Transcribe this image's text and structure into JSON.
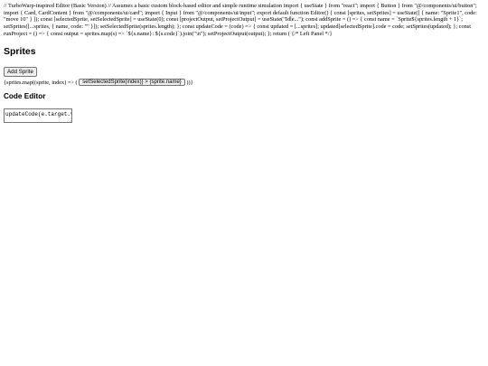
{
  "source_text": "// TurboWarp-inspired Editor (Basic Version) // Assumes a basic custom block-based editor and simple runtime simulation import { useState } from \"react\"; import { Button } from \"@/components/ui/button\"; import { Card, CardContent } from \"@/components/ui/card\"; import { Input } from \"@/components/ui/input\"; export default function Editor() { const [sprites, setSprites] = useState([ { name: \"Sprite1\", code: \"move 10\" } ]); const [selectedSprite, setSelectedSprite] = useState(0); const [projectOutput, setProjectOutput] = useState(\"Idle...\"); const addSprite = () => { const name = `Sprite${sprites.length + 1}`; setSprites([...sprites, { name, code: \"\" }]); setSelectedSprite(sprites.length); }; const updateCode = (code) => { const updated = [...sprites]; updated[selectedSprite].code = code; setSprites(updated); }; const runProject = () => { const output = sprites.map(s) => `${s.name}: ${s.code}`).join(\"\\n\"); setProjectOutput(output); }; return ( {/* Left Panel */}",
  "sprites_section": {
    "heading": "Sprites",
    "add_button_label": "Add Sprite",
    "map_prefix": "{sprites.map((sprite, index) => (",
    "sprite_button_label": "setSelectedSprite(index)} > {sprite.name}",
    "map_suffix": "))}"
  },
  "code_section": {
    "heading": "Code Editor",
    "textarea_value": "updateCode(e.target.v"
  }
}
